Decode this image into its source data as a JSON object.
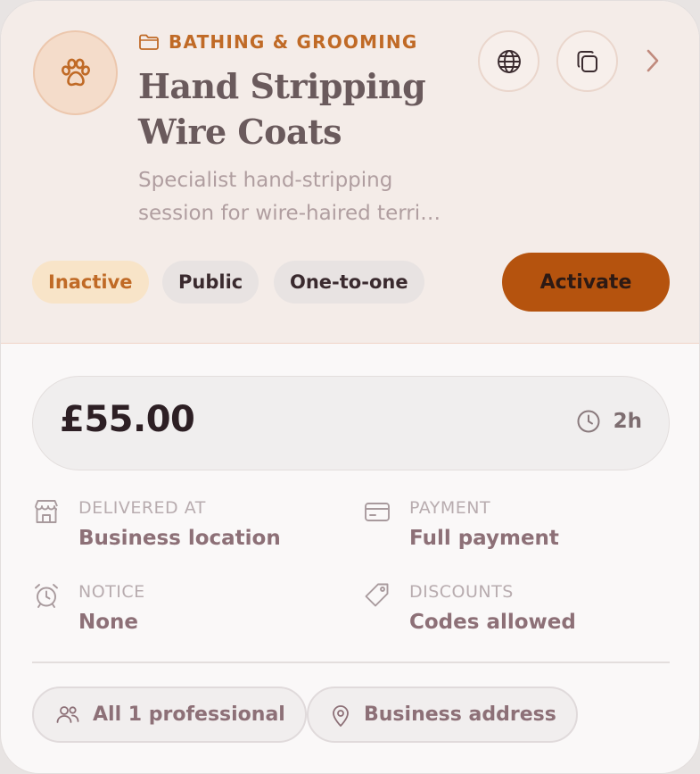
{
  "service": {
    "category": "BATHING & GROOMING",
    "title_line1": "Hand Stripping",
    "title_line2": "Wire Coats",
    "description_line1": "Specialist hand-stripping",
    "description_line2": "session for wire-haired terri…",
    "avatar_icon": "paw-icon"
  },
  "header_actions": {
    "globe_icon": "globe-icon",
    "duplicate_icon": "copy-icon",
    "next_icon": "chevron-right-icon"
  },
  "badges": {
    "status": "Inactive",
    "visibility": "Public",
    "mode": "One-to-one"
  },
  "actions": {
    "activate_label": "Activate"
  },
  "pricing": {
    "price": "£55.00",
    "duration": "2h"
  },
  "details": {
    "delivered_label": "DELIVERED AT",
    "delivered_value": "Business location",
    "payment_label": "PAYMENT",
    "payment_value": "Full payment",
    "notice_label": "NOTICE",
    "notice_value": "None",
    "discounts_label": "DISCOUNTS",
    "discounts_value": "Codes allowed"
  },
  "chips": {
    "professionals": "All 1 professional",
    "address": "Business address"
  },
  "colors": {
    "accent": "#b5530e",
    "category": "#c06a26",
    "hero_bg": "#f4ece8",
    "inactive_badge_bg": "#f8e4c8"
  }
}
